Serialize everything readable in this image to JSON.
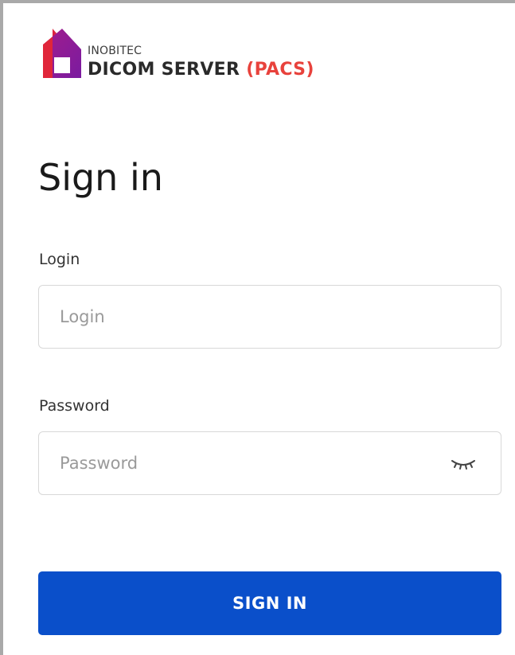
{
  "logo": {
    "subtitle": "INOBITEC",
    "product": "DICOM SERVER",
    "product_accent": "(PACS)",
    "icon": "inobitec-logo-mark"
  },
  "page": {
    "title": "Sign in"
  },
  "form": {
    "login_label": "Login",
    "login_placeholder": "Login",
    "login_value": "",
    "password_label": "Password",
    "password_placeholder": "Password",
    "password_value": "",
    "password_toggle_icon": "eye-closed-icon",
    "submit_label": "SIGN IN"
  },
  "colors": {
    "accent": "#0a4fca",
    "logo_accent": "#e8423c",
    "logo_red": "#e0263a",
    "logo_purple": "#8a1d9c"
  }
}
